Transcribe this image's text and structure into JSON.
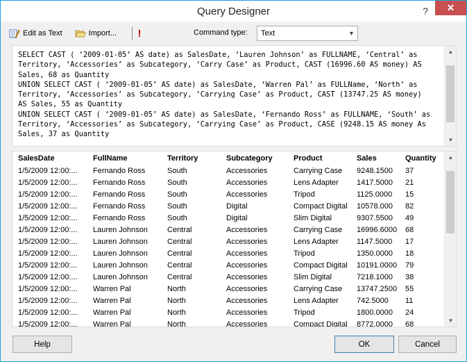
{
  "window": {
    "title": "Query Designer",
    "help_glyph": "?",
    "close_glyph": "✕"
  },
  "toolbar": {
    "edit_as_text": "Edit as Text",
    "import": "Import...",
    "run_glyph": "!",
    "command_type_label": "Command type:",
    "command_type_value": "Text"
  },
  "query": {
    "lines": [
      "SELECT CAST ( ‘2009-01-05’ AS date) as SalesDate, ‘Lauren Johnson’ as FULLNAME, ‘Central’ as",
      "Territory, ‘Accessories’ as Subcategory, ‘Carry Case’ as Product, CAST (16996.60 AS money) AS",
      "Sales, 68 as Quantity",
      "UNION SELECT CAST ( ‘2009-01-05’ AS date) as SalesDate, ‘Warren Pal’ as FULLName, ‘North’ as",
      "Territory, ‘Accessories’ as Subcategory, ‘Carrying Case’ as Product, CAST (13747.25 AS money)",
      "AS Sales, 55 as Quantity",
      "UNION SELECT CAST ( ‘2009-01-05’ AS date) as SalesDate, ‘Fernando Ross’ as FULLNAME, ‘South’ as",
      "Territory, ‘Accessories’ as Subcategory, ‘Carrying Case’ as Product, CASE (9248.15 AS money As",
      "Sales, 37 as Quantity"
    ]
  },
  "results": {
    "columns": [
      "SalesDate",
      "FullName",
      "Territory",
      "Subcategory",
      "Product",
      "Sales",
      "Quantity"
    ],
    "rows": [
      [
        "1/5/2009 12:00:...",
        "Fernando Ross",
        "South",
        "Accessories",
        "Carrying Case",
        "9248.1500",
        "37"
      ],
      [
        "1/5/2009 12:00:...",
        "Fernando Ross",
        "South",
        "Accessories",
        "Lens Adapter",
        "1417.5000",
        "21"
      ],
      [
        "1/5/2009 12:00:...",
        "Fernando Ross",
        "South",
        "Accessories",
        "Tripod",
        "1125.0000",
        "15"
      ],
      [
        "1/5/2009 12:00:...",
        "Fernando Ross",
        "South",
        "Digital",
        "Compact Digital",
        "10578.000",
        "82"
      ],
      [
        "1/5/2009 12:00:...",
        "Fernando Ross",
        "South",
        "Digital",
        "Slim Digital",
        "9307.5500",
        "49"
      ],
      [
        "1/5/2009 12:00:...",
        "Lauren Johnson",
        "Central",
        "Accessories",
        "Carrying Case",
        "16996.6000",
        "68"
      ],
      [
        "1/5/2009 12:00:...",
        "Lauren Johnson",
        "Central",
        "Accessories",
        "Lens Adapter",
        "1147.5000",
        "17"
      ],
      [
        "1/5/2009 12:00:...",
        "Lauren Johnson",
        "Central",
        "Accessories",
        "Tripod",
        "1350.0000",
        "18"
      ],
      [
        "1/5/2009 12:00:...",
        "Lauren Johnson",
        "Central",
        "Accessories",
        "Compact Digital",
        "10191.0000",
        "79"
      ],
      [
        "1/5/2009 12:00:...",
        "Lauren Johnson",
        "Central",
        "Accessories",
        "Slim Digital",
        "7218.1000",
        "38"
      ],
      [
        "1/5/2009 12:00:...",
        "Warren Pal",
        "North",
        "Accessories",
        "Carrying Case",
        "13747.2500",
        "55"
      ],
      [
        "1/5/2009 12:00:...",
        "Warren Pal",
        "North",
        "Accessories",
        "Lens Adapter",
        "742.5000",
        "11"
      ],
      [
        "1/5/2009 12:00:...",
        "Warren Pal",
        "North",
        "Accessories",
        "Tripod",
        "1800.0000",
        "24"
      ],
      [
        "1/5/2009 12:00:...",
        "Warren Pal",
        "North",
        "Accessories",
        "Compact Digital",
        "8772.0000",
        "68"
      ]
    ]
  },
  "buttons": {
    "help": "Help",
    "ok": "OK",
    "cancel": "Cancel"
  },
  "icons": {
    "edit_as_text": "edit-text-icon",
    "import": "folder-open-icon",
    "run": "run-exclamation-icon"
  },
  "colors": {
    "window_border": "#1ba1e2",
    "close_button": "#c75050",
    "run_icon": "#c00000"
  }
}
